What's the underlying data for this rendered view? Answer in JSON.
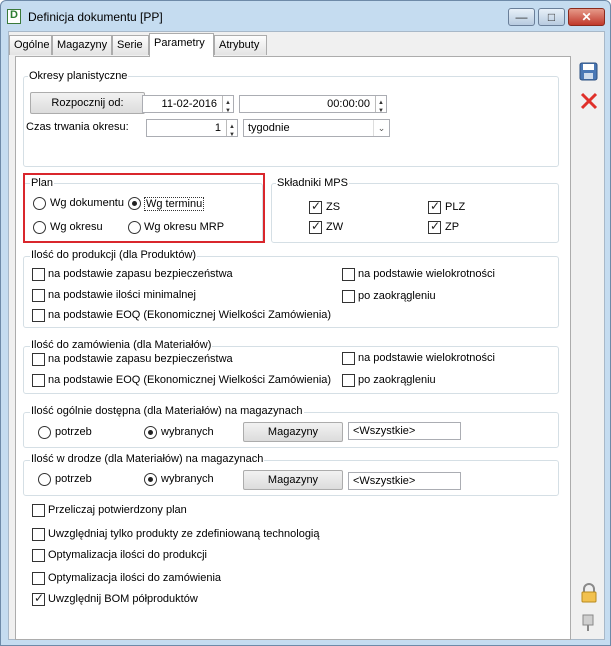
{
  "window": {
    "title": "Definicja dokumentu [PP]",
    "min_glyph": "—",
    "max_glyph": "□",
    "close_glyph": "✕"
  },
  "tabs": [
    {
      "label": "Ogólne"
    },
    {
      "label": "Magazyny"
    },
    {
      "label": "Serie"
    },
    {
      "label": "Parametry"
    },
    {
      "label": "Atrybuty"
    }
  ],
  "okresy": {
    "legend": "Okresy planistyczne",
    "start_button": "Rozpocznij od:",
    "start_date": "11-02-2016",
    "start_time": "00:00:00",
    "duration_label": "Czas trwania okresu:",
    "duration_value": "1",
    "duration_unit": "tygodnie"
  },
  "plan": {
    "legend": "Plan",
    "options": [
      {
        "label": "Wg dokumentu",
        "checked": false
      },
      {
        "label": "Wg terminu",
        "checked": true
      },
      {
        "label": "Wg okresu",
        "checked": false
      },
      {
        "label": "Wg okresu MRP",
        "checked": false
      }
    ]
  },
  "mps": {
    "legend": "Składniki MPS",
    "items": [
      {
        "label": "ZS",
        "checked": true
      },
      {
        "label": "PLZ",
        "checked": true
      },
      {
        "label": "ZW",
        "checked": true
      },
      {
        "label": "ZP",
        "checked": true
      }
    ]
  },
  "produkcja": {
    "legend": "Ilość do produkcji (dla Produktów)",
    "items": [
      {
        "label": "na podstawie zapasu bezpieczeństwa"
      },
      {
        "label": "na podstawie ilości minimalnej"
      },
      {
        "label": "na podstawie EOQ (Ekonomicznej Wielkości Zamówienia)"
      },
      {
        "label": "na podstawie wielokrotności"
      },
      {
        "label": "po zaokrągleniu"
      }
    ]
  },
  "zamowienia": {
    "legend": "Ilość do zamówienia (dla Materiałów)",
    "items": [
      {
        "label": "na podstawie zapasu bezpieczeństwa"
      },
      {
        "label": "na podstawie EOQ (Ekonomicznej Wielkości Zamówienia)"
      },
      {
        "label": "na podstawie wielokrotności"
      },
      {
        "label": "po zaokrągleniu"
      }
    ]
  },
  "dostepna": {
    "legend": "Ilość ogólnie dostępna (dla Materiałów) na magazynach",
    "opt1": "potrzeb",
    "opt2": "wybranych",
    "button": "Magazyny",
    "value": "<Wszystkie>"
  },
  "wdrodze": {
    "legend": "Ilość w drodze (dla Materiałów) na magazynach",
    "opt1": "potrzeb",
    "opt2": "wybranych",
    "button": "Magazyny",
    "value": "<Wszystkie>"
  },
  "options": [
    {
      "label": "Przeliczaj potwierdzony plan",
      "checked": false
    },
    {
      "label": "Uwzględniaj tylko produkty ze zdefiniowaną technologią",
      "checked": false
    },
    {
      "label": "Optymalizacja ilości do produkcji",
      "checked": false
    },
    {
      "label": "Optymalizacja ilości do zamówienia",
      "checked": false
    },
    {
      "label": "Uwzględnij BOM półproduktów",
      "checked": true
    }
  ],
  "colors": {
    "highlight": "#d9262c",
    "window_frame": "#c5dcf0"
  }
}
